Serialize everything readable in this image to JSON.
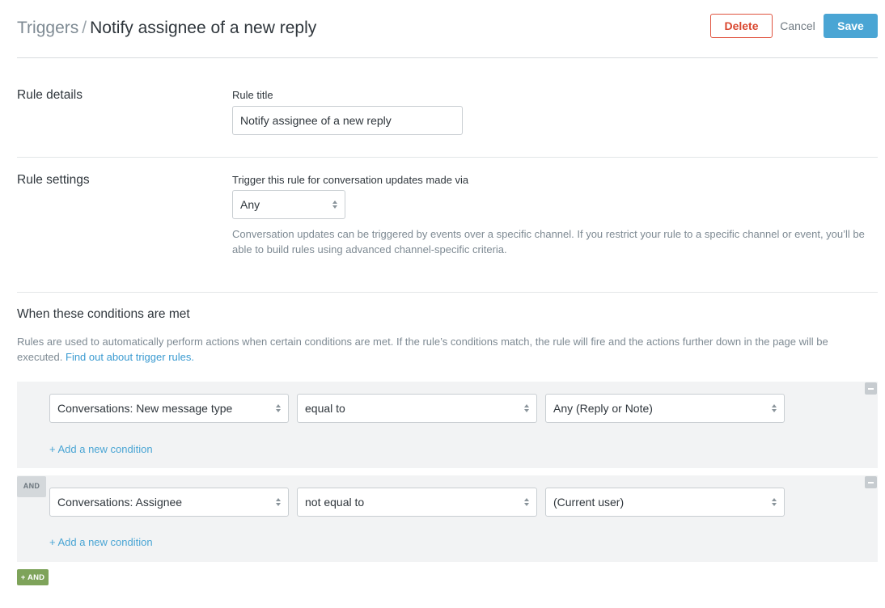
{
  "header": {
    "breadcrumb_root": "Triggers",
    "breadcrumb_separator": "/",
    "title": "Notify assignee of a new reply",
    "delete_label": "Delete",
    "cancel_label": "Cancel",
    "save_label": "Save"
  },
  "rule_details": {
    "section_label": "Rule details",
    "title_label": "Rule title",
    "title_value": "Notify assignee of a new reply"
  },
  "rule_settings": {
    "section_label": "Rule settings",
    "trigger_label": "Trigger this rule for conversation updates made via",
    "trigger_value": "Any",
    "help_text": "Conversation updates can be triggered by events over a specific channel. If you restrict your rule to a specific channel or event, you’ll be able to build rules using advanced channel-specific criteria."
  },
  "conditions": {
    "title": "When these conditions are met",
    "description": "Rules are used to automatically perform actions when certain conditions are met. If the rule’s conditions match, the rule will fire and the actions further down in the page will be executed.",
    "link_text": "Find out about trigger rules.",
    "groups": [
      {
        "field": "Conversations: New message type",
        "operator": "equal to",
        "value": "Any (Reply or Note)",
        "add_condition": "+ Add a new condition"
      },
      {
        "connector": "AND",
        "field": "Conversations: Assignee",
        "operator": "not equal to",
        "value": "(Current user)",
        "add_condition": "+ Add a new condition"
      }
    ],
    "add_and_label": "+ AND"
  },
  "colors": {
    "primary": "#4aa5d4",
    "danger": "#e0533f",
    "and_button": "#7ea35a"
  }
}
